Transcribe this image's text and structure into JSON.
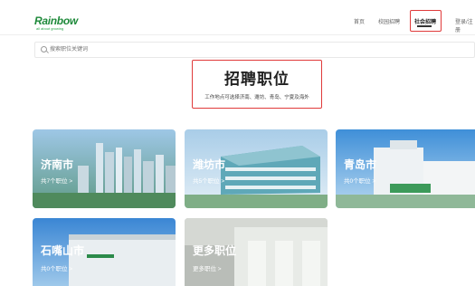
{
  "brand": {
    "name": "Rainbow",
    "tagline": "all about growing"
  },
  "nav": {
    "items": [
      {
        "label": "首页"
      },
      {
        "label": "校园招聘"
      },
      {
        "label": "社会招聘"
      },
      {
        "label": "登录/注册"
      }
    ],
    "active": "社会招聘"
  },
  "search": {
    "placeholder": "搜索职位关键词"
  },
  "main": {
    "title": "招聘职位",
    "subtitle": "工作地点可选择济南、潍坊、青岛、宁夏及海外"
  },
  "cards": [
    {
      "name": "济南市",
      "count": "共7个职位 >"
    },
    {
      "name": "潍坊市",
      "count": "共5个职位 >"
    },
    {
      "name": "青岛市",
      "count": "共0个职位 >"
    },
    {
      "name": "石嘴山市",
      "count": "共0个职位 >"
    },
    {
      "name": "更多职位",
      "count": "更多职位 >"
    }
  ],
  "colors": {
    "brand_green": "#1f8a3b",
    "highlight_red": "#e03a3a"
  }
}
